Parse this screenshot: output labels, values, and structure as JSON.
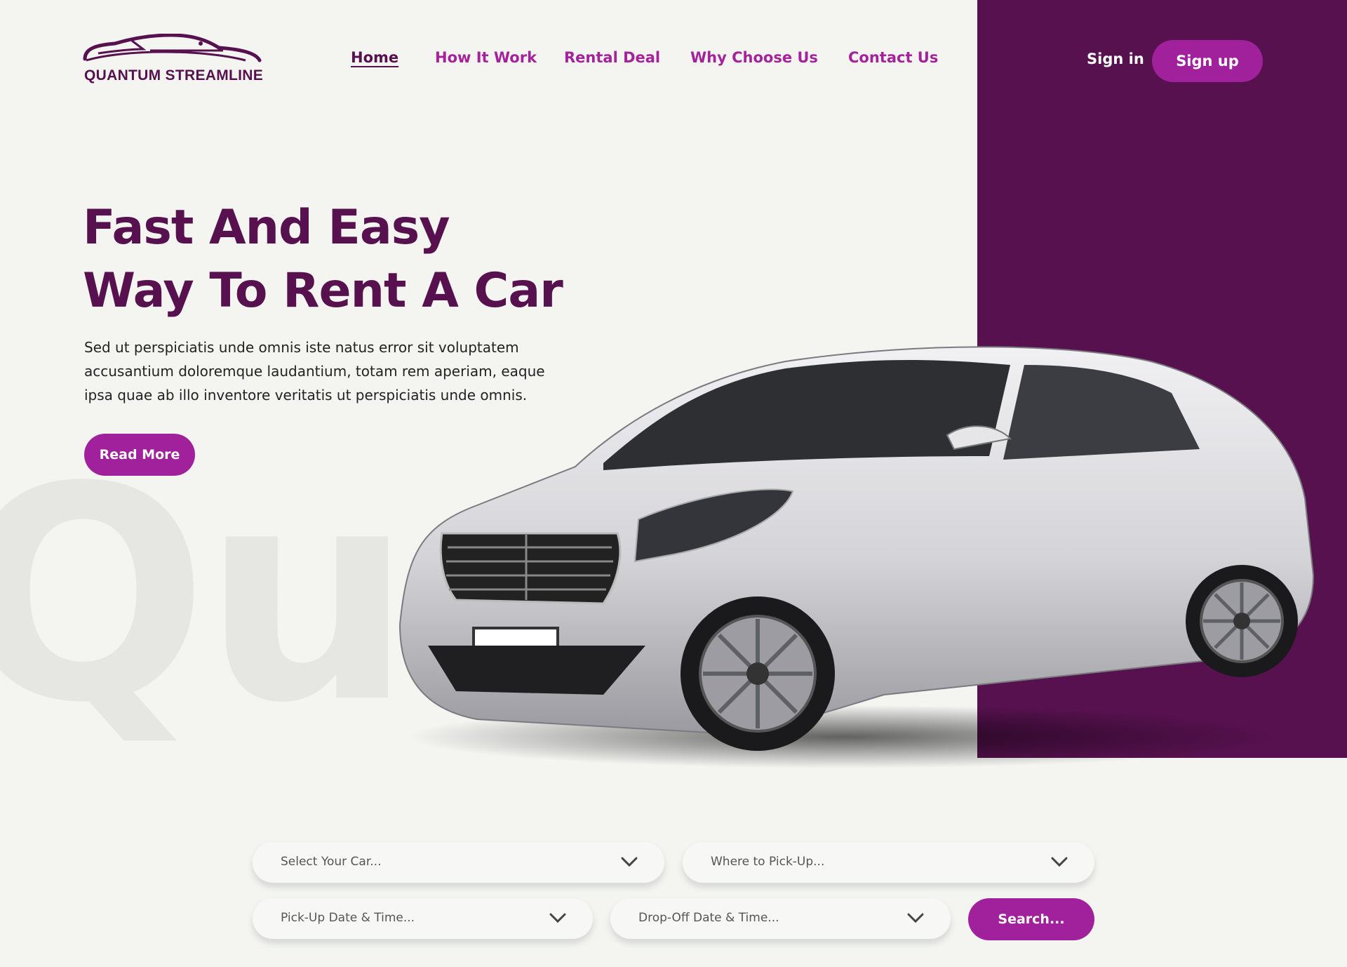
{
  "brand": {
    "name": "QUANTUM STREAMLINE",
    "color": "#56114e",
    "accent": "#a0219b"
  },
  "nav": {
    "items": [
      {
        "label": "Home",
        "active": true
      },
      {
        "label": "How It Work"
      },
      {
        "label": "Rental Deal"
      },
      {
        "label": "Why Choose Us"
      },
      {
        "label": "Contact Us"
      }
    ],
    "signin": "Sign in",
    "signup": "Sign up"
  },
  "hero": {
    "title_line1": "Fast And Easy",
    "title_line2": "Way To Rent A Car",
    "description": "Sed ut perspiciatis unde omnis iste natus error sit voluptatem accusantium doloremque laudantium, totam rem aperiam, eaque ipsa quae ab illo inventore veritatis ut perspiciatis unde omnis.",
    "cta": "Read More",
    "background_word": "Quo"
  },
  "search": {
    "car_placeholder": "Select Your Car...",
    "pickup_location_placeholder": "Where to Pick-Up...",
    "pickup_datetime_placeholder": "Pick-Up Date & Time...",
    "dropoff_datetime_placeholder": "Drop-Off Date & Time...",
    "button": "Search..."
  },
  "icons": {
    "logo": "car-silhouette-icon",
    "dropdown": "chevron-down-icon",
    "hero_image": "silver-sedan"
  }
}
